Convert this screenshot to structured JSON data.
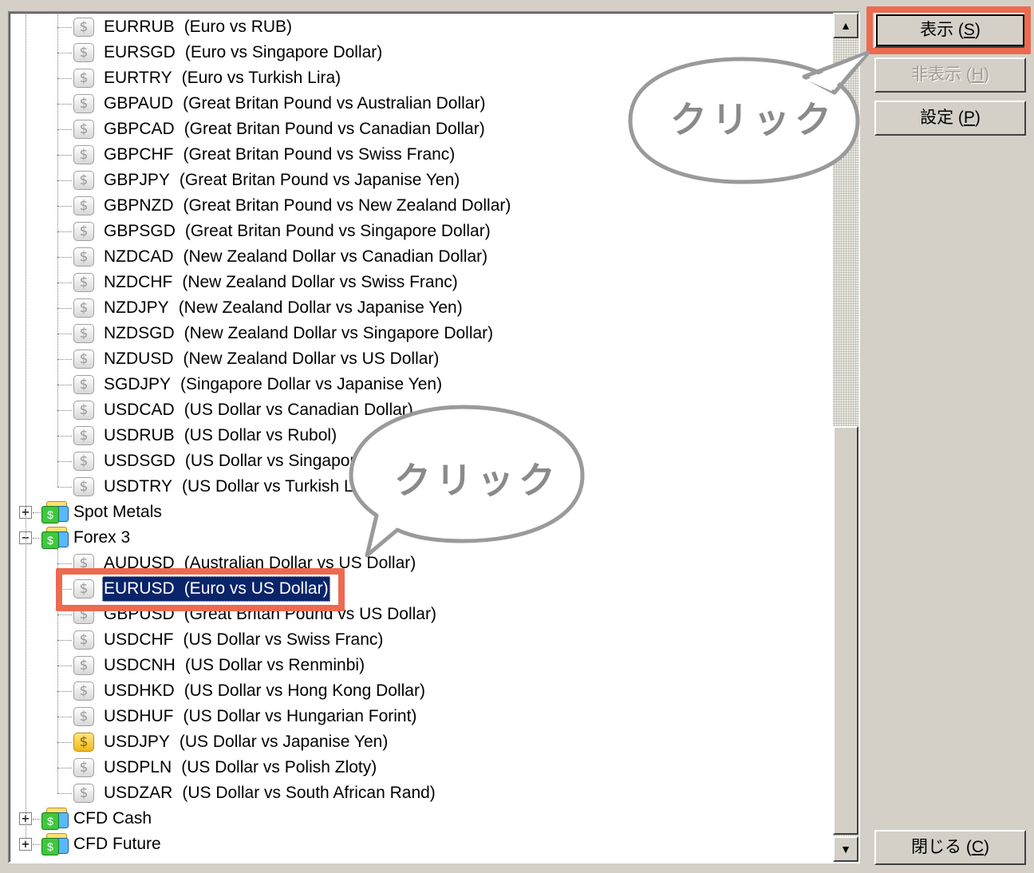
{
  "tree": {
    "forex2_items": [
      {
        "code": "EURRUB",
        "desc": "(Euro vs RUB)"
      },
      {
        "code": "EURSGD",
        "desc": "(Euro vs Singapore Dollar)"
      },
      {
        "code": "EURTRY",
        "desc": "(Euro vs Turkish Lira)"
      },
      {
        "code": "GBPAUD",
        "desc": "(Great Britan Pound vs Australian Dollar)"
      },
      {
        "code": "GBPCAD",
        "desc": "(Great Britan Pound vs Canadian Dollar)"
      },
      {
        "code": "GBPCHF",
        "desc": "(Great Britan Pound vs Swiss Franc)"
      },
      {
        "code": "GBPJPY",
        "desc": "(Great Britan Pound vs Japanise Yen)"
      },
      {
        "code": "GBPNZD",
        "desc": "(Great Britan Pound vs New Zealand Dollar)"
      },
      {
        "code": "GBPSGD",
        "desc": "(Great Britan Pound vs Singapore Dollar)"
      },
      {
        "code": "NZDCAD",
        "desc": "(New Zealand Dollar vs Canadian Dollar)"
      },
      {
        "code": "NZDCHF",
        "desc": "(New Zealand Dollar vs Swiss Franc)"
      },
      {
        "code": "NZDJPY",
        "desc": "(New Zealand Dollar vs Japanise Yen)"
      },
      {
        "code": "NZDSGD",
        "desc": "(New Zealand Dollar vs Singapore Dollar)"
      },
      {
        "code": "NZDUSD",
        "desc": "(New Zealand Dollar vs US Dollar)"
      },
      {
        "code": "SGDJPY",
        "desc": "(Singapore Dollar vs Japanise Yen)"
      },
      {
        "code": "USDCAD",
        "desc": "(US Dollar vs Canadian Dollar)"
      },
      {
        "code": "USDRUB",
        "desc": "(US Dollar vs Rubol)"
      },
      {
        "code": "USDSGD",
        "desc": "(US Dollar vs Singapore Dollar)"
      },
      {
        "code": "USDTRY",
        "desc": "(US Dollar vs Turkish Lira)"
      }
    ],
    "groups": {
      "spot_metals": "Spot Metals",
      "forex3": "Forex 3",
      "cfd_cash": "CFD Cash",
      "cfd_future": "CFD Future"
    },
    "forex3_items": [
      {
        "code": "AUDUSD",
        "desc": "(Australian Dollar vs US Dollar)",
        "selected": false,
        "gold": false
      },
      {
        "code": "EURUSD",
        "desc": "(Euro vs US Dollar)",
        "selected": true,
        "gold": false
      },
      {
        "code": "GBPUSD",
        "desc": "(Great Britan Pound vs US Dollar)",
        "selected": false,
        "gold": false
      },
      {
        "code": "USDCHF",
        "desc": "(US Dollar vs Swiss Franc)",
        "selected": false,
        "gold": false
      },
      {
        "code": "USDCNH",
        "desc": "(US Dollar vs Renminbi)",
        "selected": false,
        "gold": false
      },
      {
        "code": "USDHKD",
        "desc": "(US Dollar vs Hong Kong Dollar)",
        "selected": false,
        "gold": false
      },
      {
        "code": "USDHUF",
        "desc": "(US Dollar vs Hungarian Forint)",
        "selected": false,
        "gold": false
      },
      {
        "code": "USDJPY",
        "desc": "(US Dollar vs Japanise Yen)",
        "selected": false,
        "gold": true
      },
      {
        "code": "USDPLN",
        "desc": "(US Dollar vs Polish Zloty)",
        "selected": false,
        "gold": false
      },
      {
        "code": "USDZAR",
        "desc": "(US Dollar vs South African Rand)",
        "selected": false,
        "gold": false
      }
    ],
    "symbol_glyph": "$",
    "folder_glyph": "$",
    "expand_glyph": "+",
    "collapse_glyph": "−"
  },
  "buttons": {
    "show": {
      "label": "表示 (",
      "key": "S",
      "suffix": ")"
    },
    "hide": {
      "label": "非表示 (",
      "key": "H",
      "suffix": ")"
    },
    "settings": {
      "label": "設定 (",
      "key": "P",
      "suffix": ")"
    },
    "close": {
      "label": "閉じる (",
      "key": "C",
      "suffix": ")"
    }
  },
  "scrollbar": {
    "up_glyph": "▲",
    "down_glyph": "▼"
  },
  "annotations": {
    "callout_1": "クリック",
    "callout_2": "クリック"
  },
  "colors": {
    "highlight_red": "#ec6a4f",
    "selection_blue": "#0a246a",
    "window_bg": "#d4d0c8"
  }
}
